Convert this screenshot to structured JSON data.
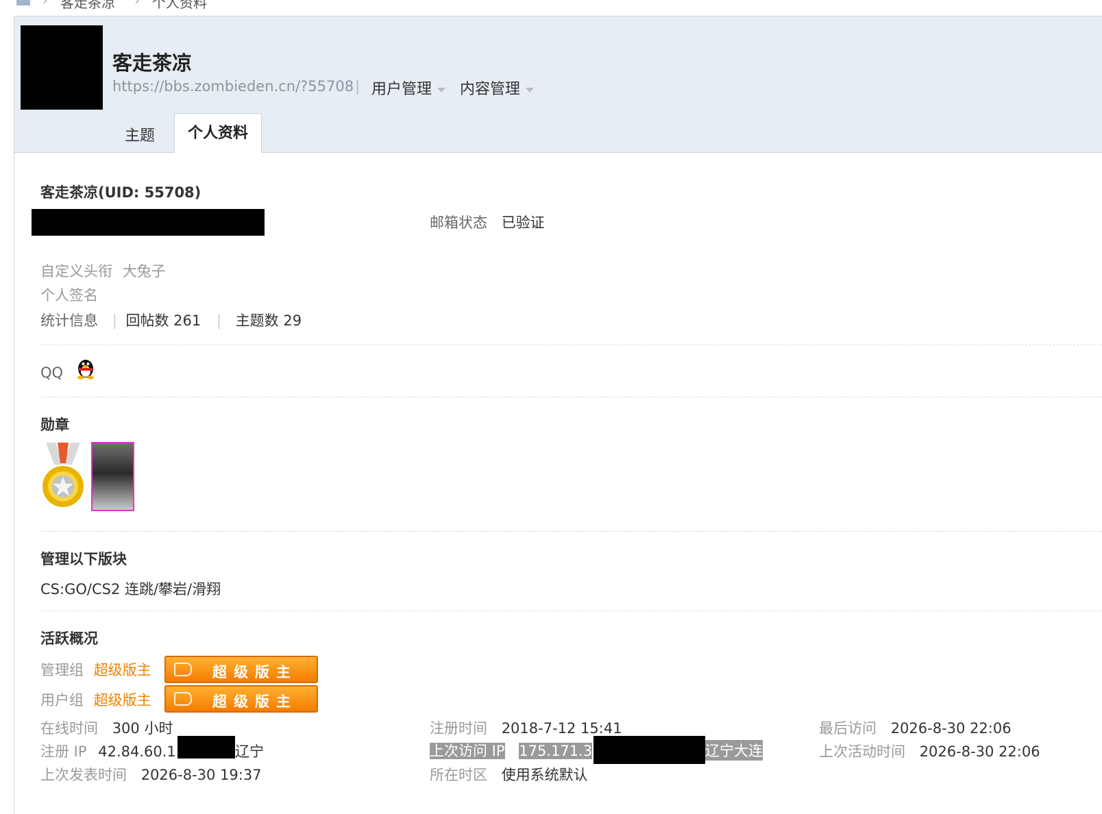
{
  "breadcrumb": {
    "crumb1": "客走茶凉",
    "crumb2": "个人资料",
    "sep": "›"
  },
  "header": {
    "username": "客走茶凉",
    "url": "https://bbs.zombieden.cn/?55708",
    "sep": "|",
    "menus": [
      "用户管理",
      "内容管理"
    ],
    "tabs": [
      "主题",
      "个人资料"
    ]
  },
  "profile": {
    "title_line": "客走茶凉(UID: 55708)",
    "email_label": "邮箱状态",
    "email_value": "已验证",
    "custom_title_label": "自定义头衔",
    "custom_title_value": "大兔子",
    "signature_label": "个人签名",
    "stats_label": "统计信息",
    "stats_sep": "|",
    "replies": "回帖数 261",
    "topics": "主题数 29",
    "qq_label": "QQ"
  },
  "medals": {
    "heading": "勋章"
  },
  "moderates": {
    "heading": "管理以下版块",
    "value": "CS:GO/CS2 连跳/攀岩/滑翔"
  },
  "activity": {
    "heading": "活跃概况",
    "admin_group_label": "管理组",
    "admin_group_value": "超级版主",
    "user_group_label": "用户组",
    "user_group_value": "超级版主",
    "badge_text": "超级版主",
    "online_label": "在线时间",
    "online_value": "300 小时",
    "reg_time_label": "注册时间",
    "reg_time_value": "2018-7-12 15:41",
    "last_visit_label": "最后访问",
    "last_visit_value": "2026-8-30 22:06",
    "reg_ip_label": "注册 IP",
    "reg_ip_value": "42.84.60.1",
    "reg_ip_loc": "辽宁",
    "last_ip_label": "上次访问 IP",
    "last_ip_value": "175.171.3",
    "last_ip_loc": "辽宁大连",
    "last_active_label": "上次活动时间",
    "last_active_value": "2026-8-30 22:06",
    "last_post_label": "上次发表时间",
    "last_post_value": "2026-8-30 19:37",
    "timezone_label": "所在时区",
    "timezone_value": "使用系统默认"
  },
  "colors": {
    "header_bg": "#e7edf4",
    "accent_orange": "#f08200",
    "badge_orange": "#f47c00"
  },
  "icons": [
    "home-icon",
    "qq-penguin-icon",
    "medal-icon",
    "medal-portrait-icon",
    "hand-icon",
    "caret-down-icon"
  ]
}
